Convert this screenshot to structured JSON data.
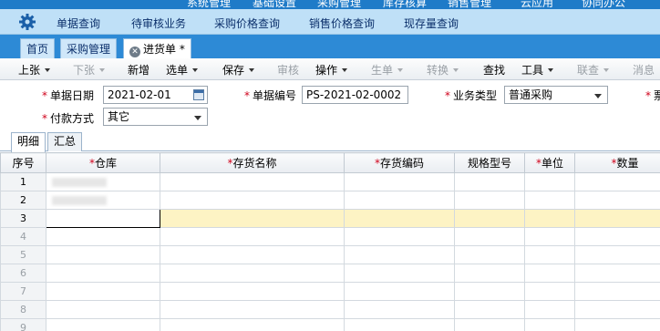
{
  "top_menu": [
    "系统管理",
    "基础设置",
    "采购管理",
    "库存核算",
    "销售管理",
    "云应用",
    "协同办公"
  ],
  "quick_nav": [
    "单据查询",
    "待审核业务",
    "采购价格查询",
    "销售价格查询",
    "现存量查询"
  ],
  "tabs": [
    {
      "label": "首页",
      "active": false
    },
    {
      "label": "采购管理",
      "active": false
    },
    {
      "label": "进货单 *",
      "active": true
    }
  ],
  "toolbar": [
    {
      "label": "上张",
      "dropdown": true,
      "disabled": false
    },
    {
      "label": "下张",
      "dropdown": true,
      "disabled": true
    },
    {
      "label": "新增",
      "dropdown": false,
      "disabled": false
    },
    {
      "label": "选单",
      "dropdown": true,
      "disabled": false
    },
    {
      "label": "保存",
      "dropdown": true,
      "disabled": false
    },
    {
      "label": "审核",
      "dropdown": false,
      "disabled": true
    },
    {
      "label": "操作",
      "dropdown": true,
      "disabled": false
    },
    {
      "label": "生单",
      "dropdown": true,
      "disabled": true
    },
    {
      "label": "转换",
      "dropdown": true,
      "disabled": true
    },
    {
      "label": "查找",
      "dropdown": false,
      "disabled": false
    },
    {
      "label": "工具",
      "dropdown": true,
      "disabled": false
    },
    {
      "label": "联查",
      "dropdown": true,
      "disabled": true
    },
    {
      "label": "消息",
      "dropdown": false,
      "disabled": true
    }
  ],
  "form": {
    "date_label": "单据日期",
    "date_value": "2021-02-01",
    "code_label": "单据编号",
    "code_value": "PS-2021-02-0002",
    "biztype_label": "业务类型",
    "biztype_value": "普通采购",
    "cutoff_label": "票",
    "payment_label": "付款方式",
    "payment_value": "其它"
  },
  "subtabs": [
    "明细",
    "汇总"
  ],
  "grid": {
    "columns": [
      "序号",
      "仓库",
      "存货名称",
      "存货编码",
      "规格型号",
      "单位",
      "数量"
    ],
    "required": [
      false,
      true,
      true,
      true,
      false,
      true,
      true
    ],
    "row_numbers": [
      "1",
      "2",
      "3",
      "4",
      "5",
      "6",
      "7",
      "8",
      "9"
    ],
    "current_row": 3
  },
  "colors": {
    "accent": "#1f7bc8",
    "quick_bar": "#bfe0f7",
    "required": "#d0021b",
    "highlight_row": "#fdf3c4"
  }
}
